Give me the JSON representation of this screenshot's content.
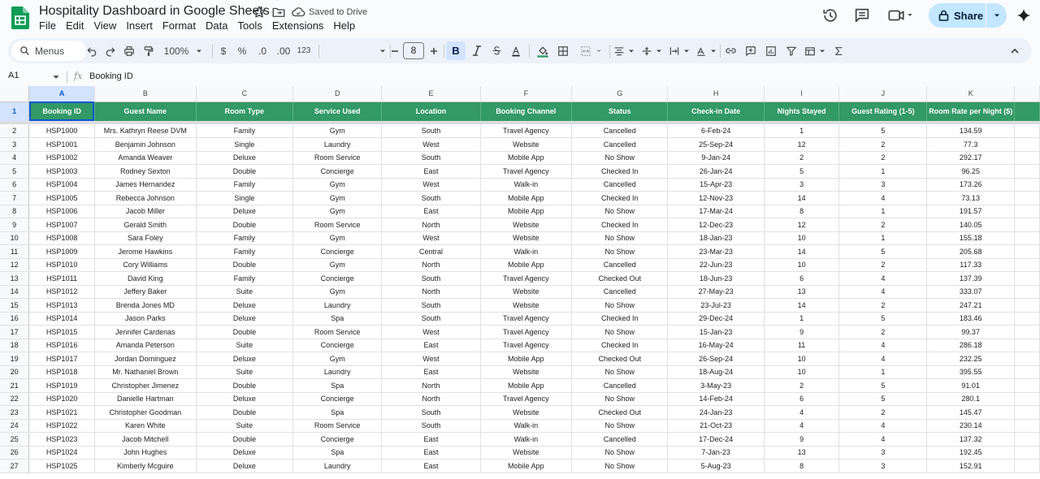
{
  "app": {
    "title": "Hospitality Dashboard in Google Sheets",
    "saved_status": "Saved to Drive",
    "share_label": "Share",
    "accent": "#c2e7ff",
    "header_green": "#339966"
  },
  "menu": [
    "File",
    "Edit",
    "View",
    "Insert",
    "Format",
    "Data",
    "Tools",
    "Extensions",
    "Help"
  ],
  "toolbar": {
    "search_label": "Menus",
    "zoom": "100%",
    "currency": "$",
    "percent": "%",
    "dec_decrease": ".0",
    "dec_increase": ".00",
    "number_format": "123",
    "font_size": "8",
    "bold": "B"
  },
  "formula_bar": {
    "cell_ref": "A1",
    "fx": "fx",
    "value": "Booking ID"
  },
  "sheet": {
    "column_letters": [
      "A",
      "B",
      "C",
      "D",
      "E",
      "F",
      "G",
      "H",
      "I",
      "J",
      "K"
    ],
    "headers": [
      "Booking ID",
      "Guest Name",
      "Room Type",
      "Service Used",
      "Location",
      "Booking Channel",
      "Status",
      "Check-in Date",
      "Nights Stayed",
      "Guest Rating (1-5)",
      "Room Rate per Night ($)"
    ],
    "header_row_number": "1",
    "rows": [
      {
        "n": "2",
        "c": [
          "HSP1000",
          "Mrs. Kathryn Reese DVM",
          "Family",
          "Gym",
          "South",
          "Travel Agency",
          "Cancelled",
          "6-Feb-24",
          "1",
          "5",
          "134.59"
        ]
      },
      {
        "n": "3",
        "c": [
          "HSP1001",
          "Benjamin Johnson",
          "Single",
          "Laundry",
          "West",
          "Website",
          "Cancelled",
          "25-Sep-24",
          "12",
          "2",
          "77.3"
        ]
      },
      {
        "n": "4",
        "c": [
          "HSP1002",
          "Amanda Weaver",
          "Deluxe",
          "Room Service",
          "South",
          "Mobile App",
          "No Show",
          "9-Jan-24",
          "2",
          "2",
          "292.17"
        ]
      },
      {
        "n": "5",
        "c": [
          "HSP1003",
          "Rodney Sexton",
          "Double",
          "Concierge",
          "East",
          "Travel Agency",
          "Checked In",
          "26-Jan-24",
          "5",
          "1",
          "96.25"
        ]
      },
      {
        "n": "6",
        "c": [
          "HSP1004",
          "James Hernandez",
          "Family",
          "Gym",
          "West",
          "Walk-in",
          "Cancelled",
          "15-Apr-23",
          "3",
          "3",
          "173.26"
        ]
      },
      {
        "n": "7",
        "c": [
          "HSP1005",
          "Rebecca Johnson",
          "Single",
          "Gym",
          "South",
          "Mobile App",
          "Checked In",
          "12-Nov-23",
          "14",
          "4",
          "73.13"
        ]
      },
      {
        "n": "8",
        "c": [
          "HSP1006",
          "Jacob Miller",
          "Deluxe",
          "Gym",
          "East",
          "Mobile App",
          "No Show",
          "17-Mar-24",
          "8",
          "1",
          "191.57"
        ]
      },
      {
        "n": "9",
        "c": [
          "HSP1007",
          "Gerald Smith",
          "Double",
          "Room Service",
          "North",
          "Website",
          "Checked In",
          "12-Dec-23",
          "12",
          "2",
          "140.05"
        ]
      },
      {
        "n": "10",
        "c": [
          "HSP1008",
          "Sara Foley",
          "Family",
          "Gym",
          "West",
          "Website",
          "No Show",
          "18-Jan-23",
          "10",
          "1",
          "155.18"
        ]
      },
      {
        "n": "11",
        "c": [
          "HSP1009",
          "Jerome Hawkins",
          "Family",
          "Concierge",
          "Central",
          "Walk-in",
          "No Show",
          "23-Mar-23",
          "14",
          "5",
          "205.68"
        ]
      },
      {
        "n": "12",
        "c": [
          "HSP1010",
          "Cory Williams",
          "Double",
          "Gym",
          "North",
          "Mobile App",
          "Cancelled",
          "22-Jun-23",
          "10",
          "2",
          "117.33"
        ]
      },
      {
        "n": "13",
        "c": [
          "HSP1011",
          "David King",
          "Family",
          "Concierge",
          "South",
          "Travel Agency",
          "Checked Out",
          "18-Jun-23",
          "6",
          "4",
          "137.39"
        ]
      },
      {
        "n": "14",
        "c": [
          "HSP1012",
          "Jeffery Baker",
          "Suite",
          "Gym",
          "North",
          "Website",
          "Cancelled",
          "27-May-23",
          "13",
          "4",
          "333.07"
        ]
      },
      {
        "n": "15",
        "c": [
          "HSP1013",
          "Brenda Jones MD",
          "Deluxe",
          "Laundry",
          "South",
          "Website",
          "No Show",
          "23-Jul-23",
          "14",
          "2",
          "247.21"
        ]
      },
      {
        "n": "16",
        "c": [
          "HSP1014",
          "Jason Parks",
          "Deluxe",
          "Spa",
          "South",
          "Travel Agency",
          "Checked In",
          "29-Dec-24",
          "1",
          "5",
          "183.46"
        ]
      },
      {
        "n": "17",
        "c": [
          "HSP1015",
          "Jennifer Cardenas",
          "Double",
          "Room Service",
          "West",
          "Travel Agency",
          "No Show",
          "15-Jan-23",
          "9",
          "2",
          "99.37"
        ]
      },
      {
        "n": "18",
        "c": [
          "HSP1016",
          "Amanda Peterson",
          "Suite",
          "Concierge",
          "East",
          "Travel Agency",
          "Checked In",
          "16-May-24",
          "11",
          "4",
          "286.18"
        ]
      },
      {
        "n": "19",
        "c": [
          "HSP1017",
          "Jordan Dominguez",
          "Deluxe",
          "Gym",
          "West",
          "Mobile App",
          "Checked Out",
          "26-Sep-24",
          "10",
          "4",
          "232.25"
        ]
      },
      {
        "n": "20",
        "c": [
          "HSP1018",
          "Mr. Nathaniel Brown",
          "Suite",
          "Laundry",
          "East",
          "Website",
          "No Show",
          "18-Aug-24",
          "10",
          "1",
          "395.55"
        ]
      },
      {
        "n": "21",
        "c": [
          "HSP1019",
          "Christopher Jimenez",
          "Double",
          "Spa",
          "North",
          "Mobile App",
          "Cancelled",
          "3-May-23",
          "2",
          "5",
          "91.01"
        ]
      },
      {
        "n": "22",
        "c": [
          "HSP1020",
          "Danielle Hartman",
          "Deluxe",
          "Concierge",
          "North",
          "Travel Agency",
          "No Show",
          "14-Feb-24",
          "6",
          "5",
          "280.1"
        ]
      },
      {
        "n": "23",
        "c": [
          "HSP1021",
          "Christopher Goodman",
          "Double",
          "Spa",
          "South",
          "Website",
          "Checked Out",
          "24-Jan-23",
          "4",
          "2",
          "145.47"
        ]
      },
      {
        "n": "24",
        "c": [
          "HSP1022",
          "Karen White",
          "Suite",
          "Room Service",
          "South",
          "Walk-in",
          "No Show",
          "21-Oct-23",
          "4",
          "4",
          "230.14"
        ]
      },
      {
        "n": "25",
        "c": [
          "HSP1023",
          "Jacob Mitchell",
          "Double",
          "Concierge",
          "East",
          "Walk-in",
          "Cancelled",
          "17-Dec-24",
          "9",
          "4",
          "137.32"
        ]
      },
      {
        "n": "26",
        "c": [
          "HSP1024",
          "John Hughes",
          "Deluxe",
          "Spa",
          "East",
          "Website",
          "No Show",
          "7-Jan-23",
          "13",
          "3",
          "192.45"
        ]
      },
      {
        "n": "27",
        "c": [
          "HSP1025",
          "Kimberly Mcguire",
          "Deluxe",
          "Laundry",
          "East",
          "Mobile App",
          "No Show",
          "5-Aug-23",
          "8",
          "3",
          "152.91"
        ]
      }
    ]
  }
}
